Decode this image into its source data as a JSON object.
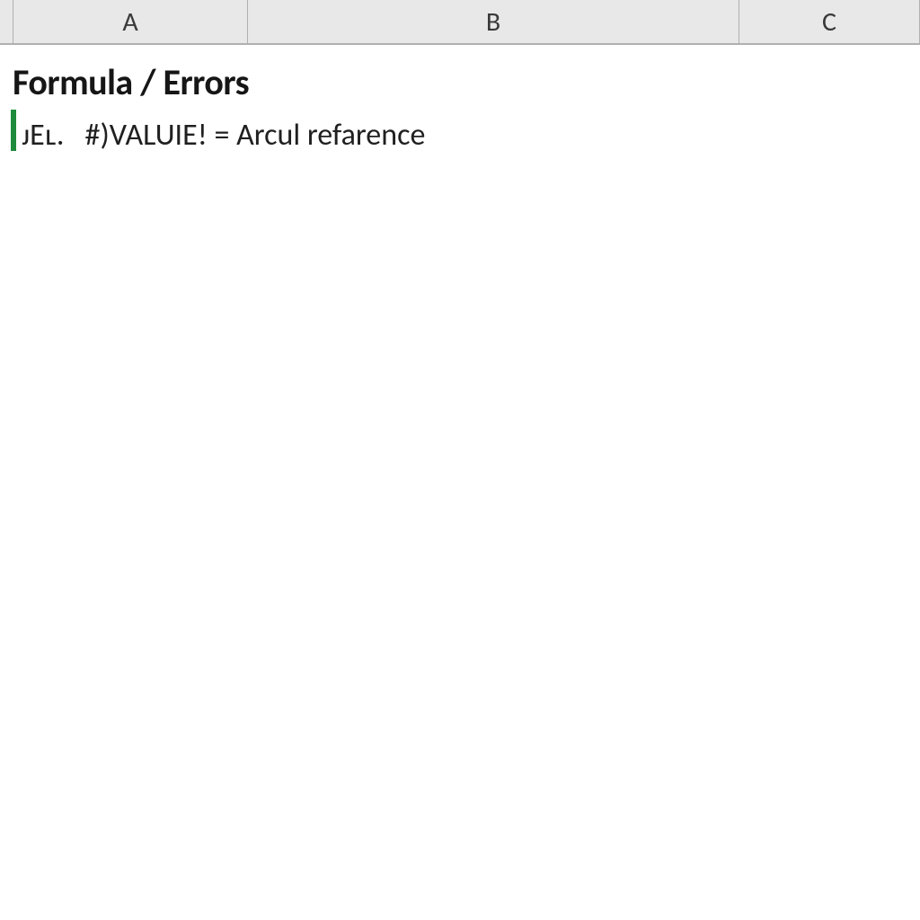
{
  "columns": {
    "A": "A",
    "B": "B",
    "C": "C"
  },
  "cells": {
    "title": "Formula / Errors",
    "row2": {
      "prefix": "ᴊEʟ.",
      "rest": "   #)VALUIE! = Arcul refarence"
    }
  }
}
